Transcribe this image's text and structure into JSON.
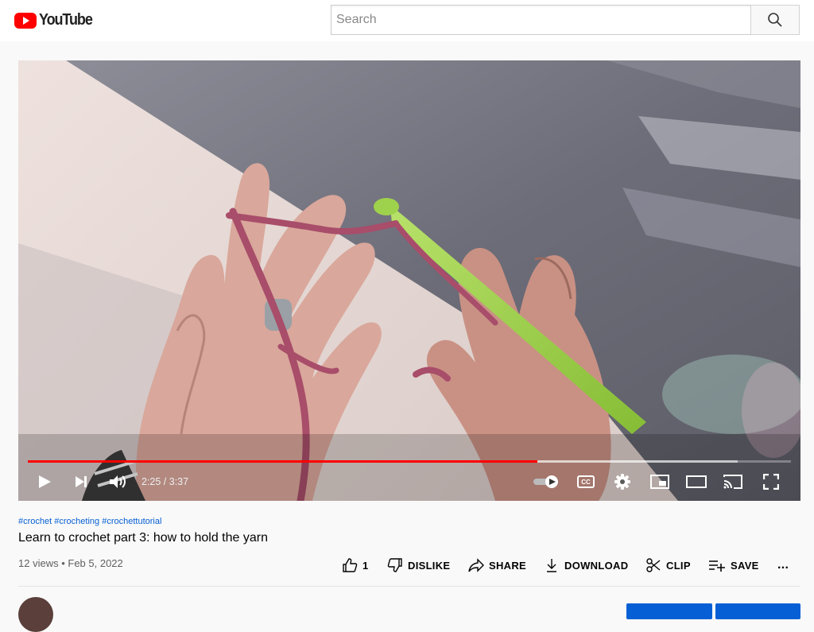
{
  "header": {
    "logo_text": "YouTube",
    "search_placeholder": "Search"
  },
  "player": {
    "current_time": "2:25",
    "duration": "3:37",
    "time_display": "2:25 / 3:37",
    "progress_fraction": 0.668,
    "buffered_fraction": 0.93,
    "cc_label": "CC",
    "icons": [
      "play-icon",
      "next-icon",
      "volume-icon",
      "autoplay-toggle-icon",
      "cc-icon",
      "settings-icon",
      "miniplayer-icon",
      "theater-icon",
      "cast-icon",
      "fullscreen-icon"
    ]
  },
  "video": {
    "hashtags": [
      "#crochet",
      "#crocheting",
      "#crochettutorial"
    ],
    "title": "Learn to crochet part 3: how to hold the yarn",
    "views": "12 views",
    "date": "Feb 5, 2022"
  },
  "actions": {
    "like_count": "1",
    "dislike_label": "DISLIKE",
    "share_label": "SHARE",
    "download_label": "DOWNLOAD",
    "clip_label": "CLIP",
    "save_label": "SAVE",
    "more_label": "..."
  },
  "colors": {
    "brand_red": "#ff0000",
    "link_blue": "#065fd4",
    "text_primary": "#030303",
    "text_secondary": "#606060"
  }
}
